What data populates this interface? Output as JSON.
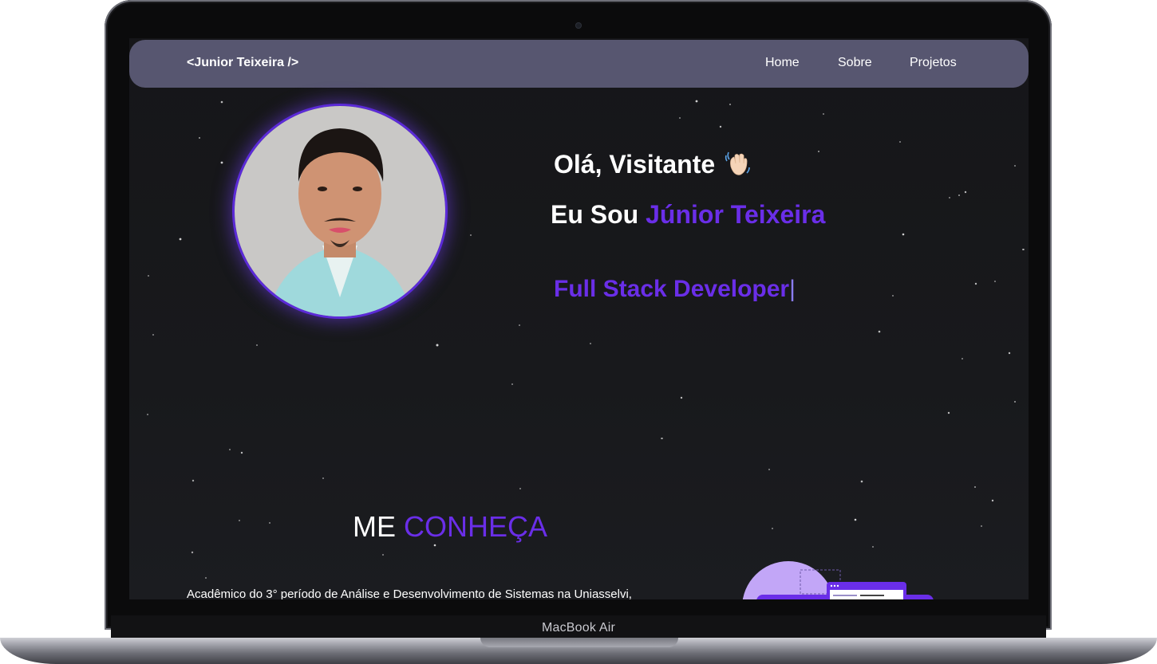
{
  "device": {
    "model_label": "MacBook Air"
  },
  "navbar": {
    "brand": "<Junior Teixeira />",
    "links": [
      "Home",
      "Sobre",
      "Projetos"
    ]
  },
  "hero": {
    "greeting": "Olá, Visitante",
    "greeting_icon": "waving-hand-icon",
    "intro_prefix": "Eu Sou",
    "name": "Júnior Teixeira",
    "role": "Full Stack Developer",
    "cursor": "|"
  },
  "about": {
    "title_white": "ME",
    "title_accent": "CONHEÇA",
    "text": "Acadêmico do 3° período de Análise e Desenvolvimento de Sistemas na Uniasselvi,"
  },
  "colors": {
    "accent": "#6a2ee8",
    "navbar_bg": "#575670",
    "page_bg": "#18191c"
  }
}
